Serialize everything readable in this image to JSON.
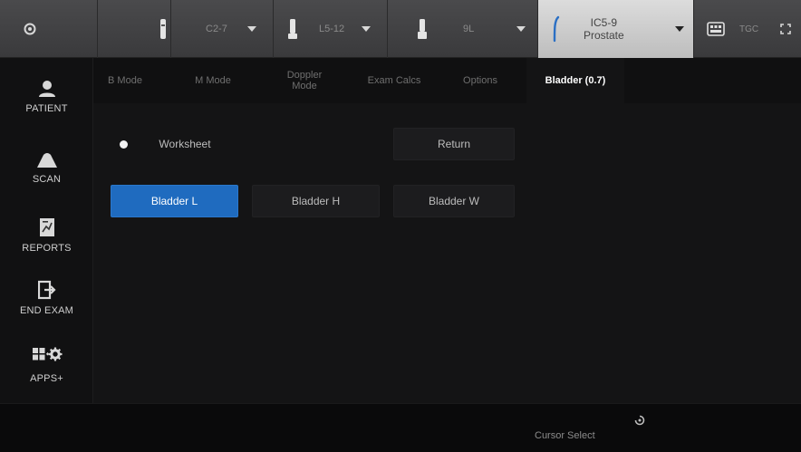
{
  "probes": [
    {
      "icon": "probe-icon",
      "label": ""
    },
    {
      "icon": "probe-c2-7-icon",
      "label": "C2-7"
    },
    {
      "icon": "probe-l5-12-icon",
      "label": "L5-12"
    },
    {
      "icon": "probe-9l-icon",
      "label": "9L"
    },
    {
      "icon": "probe-ic5-9-icon",
      "label_line1": "IC5-9",
      "label_line2": "Prostate",
      "active": true
    }
  ],
  "toolbar": {
    "tgc_label": "TGC"
  },
  "nav": {
    "patient": "PATIENT",
    "scan": "SCAN",
    "reports": "REPORTS",
    "end_exam": "END EXAM",
    "apps": "APPS+"
  },
  "tabs": [
    {
      "label": "B Mode"
    },
    {
      "label": "M Mode"
    },
    {
      "label_line1": "Doppler",
      "label_line2": "Mode"
    },
    {
      "label": "Exam Calcs"
    },
    {
      "label": "Options"
    },
    {
      "label": "Bladder (0.7)",
      "active": true
    }
  ],
  "controls": {
    "worksheet": "Worksheet",
    "return": "Return",
    "bladder_l": "Bladder L",
    "bladder_h": "Bladder H",
    "bladder_w": "Bladder W"
  },
  "status": {
    "cursor_select": "Cursor Select"
  },
  "colors": {
    "accent": "#1f6bbf",
    "background": "#141415",
    "topbar": "#3f3f41"
  }
}
